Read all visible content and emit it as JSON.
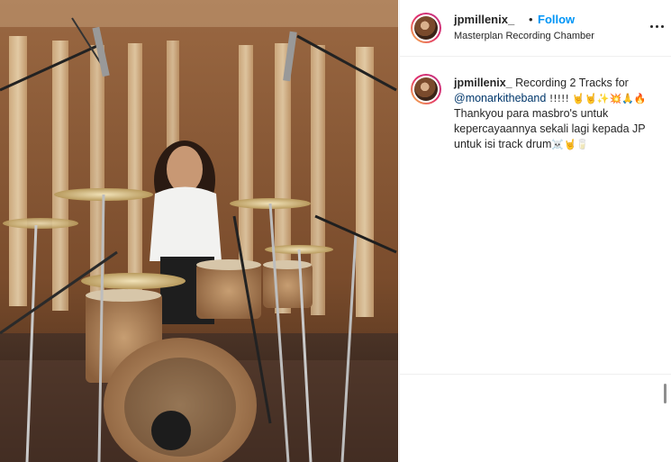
{
  "post": {
    "username": "jpmillenix_",
    "separator": "•",
    "follow_label": "Follow",
    "location": "Masterplan Recording Chamber",
    "more_icon": "more-horizontal-icon"
  },
  "caption": {
    "username": "jpmillenix_",
    "text_before_mention": "Recording 2 Tracks for",
    "mention": "@monarkitheband",
    "text_after_mention": "!!!!! 🤘🤘✨💥🙏🔥",
    "line2": "Thankyou para masbro's untuk",
    "line3": "kepercayaannya sekali lagi kepada JP",
    "line4": "untuk isi track drum",
    "line4_emoji": "☠️🤘🥛"
  },
  "colors": {
    "follow": "#0095f6",
    "mention": "#00376b",
    "avatar_ring_start": "#f7c04a",
    "avatar_ring_end": "#c13584"
  }
}
